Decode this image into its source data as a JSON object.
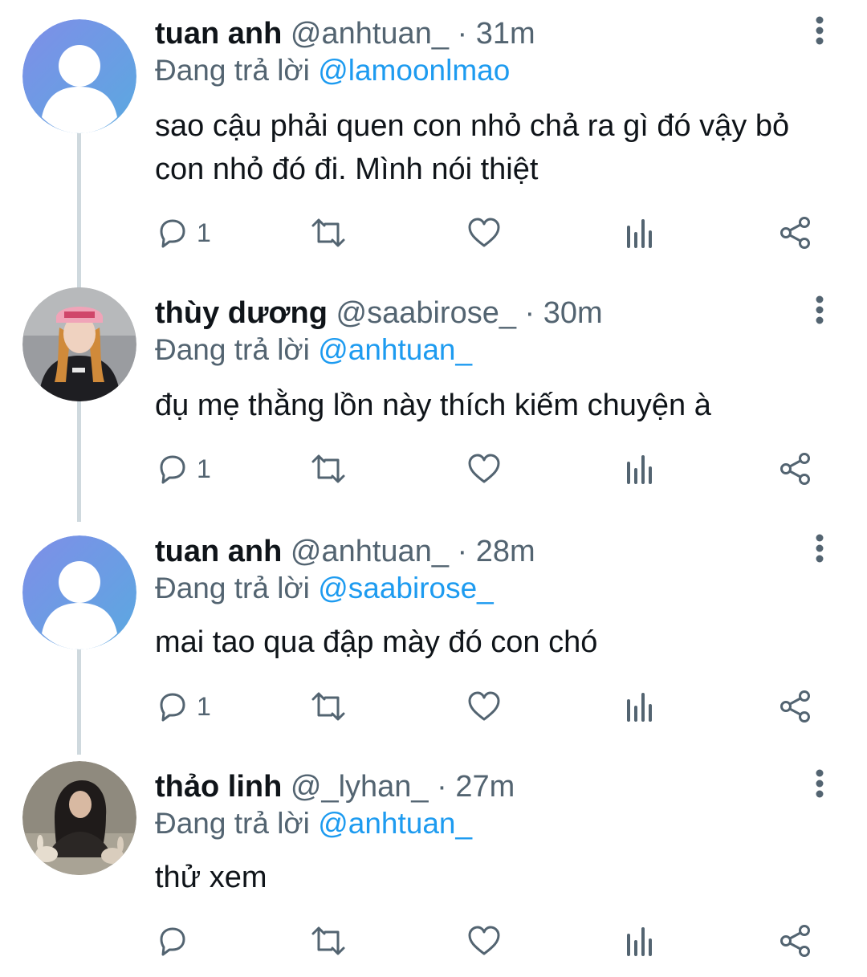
{
  "colors": {
    "text": "#0f1419",
    "secondary": "#536471",
    "accent": "#1d9bf0",
    "thread_line": "#cfd9de",
    "default_avatar_bg": "#6a9ee3"
  },
  "tweets": [
    {
      "name": "tuan anh",
      "handle": "@anhtuan_",
      "separator": "·",
      "time": "31m",
      "reply_prefix": "Đang trả lời",
      "reply_to": "@lamoonlmao",
      "text": "sao cậu phải quen con nhỏ chả ra gì đó vậy bỏ con nhỏ đó đi. Mình nói thiệt",
      "reply_count": "1",
      "avatar": "default-avatar-icon"
    },
    {
      "name": "thùy dương",
      "handle": "@saabirose_",
      "separator": "·",
      "time": "30m",
      "reply_prefix": "Đang trả lời",
      "reply_to": "@anhtuan_",
      "text": "đụ mẹ thằng lồn này thích kiếm chuyện à",
      "reply_count": "1",
      "avatar": "photo-avatar"
    },
    {
      "name": "tuan anh",
      "handle": "@anhtuan_",
      "separator": "·",
      "time": "28m",
      "reply_prefix": "Đang trả lời",
      "reply_to": "@saabirose_",
      "text": "mai tao qua đập mày đó con chó",
      "reply_count": "1",
      "avatar": "default-avatar-icon"
    },
    {
      "name": "thảo linh",
      "handle": "@_lyhan_",
      "separator": "·",
      "time": "27m",
      "reply_prefix": "Đang trả lời",
      "reply_to": "@anhtuan_",
      "text": "thử xem",
      "reply_count": "",
      "avatar": "photo-avatar"
    }
  ],
  "icons": {
    "reply": "reply-icon",
    "retweet": "retweet-icon",
    "like": "heart-icon",
    "views": "analytics-icon",
    "share": "share-icon",
    "more": "more-vertical-icon"
  }
}
